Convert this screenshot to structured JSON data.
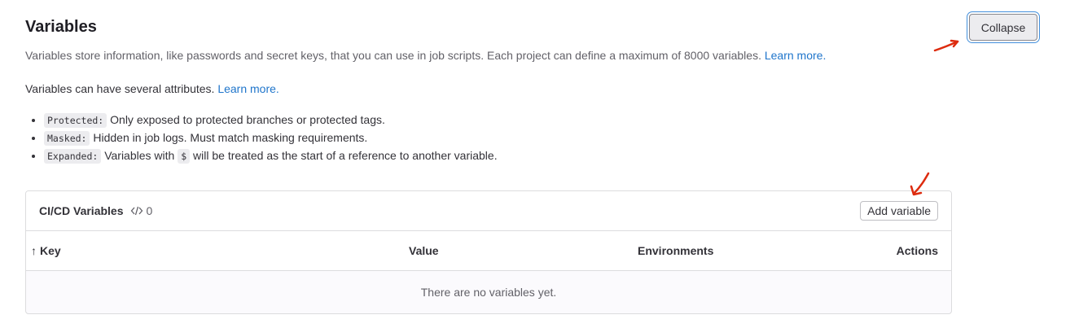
{
  "section": {
    "title": "Variables",
    "collapse_label": "Collapse",
    "description": "Variables store information, like passwords and secret keys, that you can use in job scripts. Each project can define a maximum of 8000 variables.",
    "description_link": "Learn more.",
    "attributes_intro": "Variables can have several attributes.",
    "attributes_link": "Learn more.",
    "attributes": [
      {
        "code": "Protected:",
        "text": "Only exposed to protected branches or protected tags."
      },
      {
        "code": "Masked:",
        "text": "Hidden in job logs. Must match masking requirements."
      },
      {
        "code": "Expanded:",
        "text_before": "Variables with",
        "inline_code": "$",
        "text_after": "will be treated as the start of a reference to another variable."
      }
    ]
  },
  "card": {
    "title": "CI/CD Variables",
    "count": "0",
    "count_icon": "code-icon",
    "add_label": "Add variable"
  },
  "table": {
    "sort_indicator": "↑",
    "columns": {
      "key": "Key",
      "value": "Value",
      "environments": "Environments",
      "actions": "Actions"
    },
    "empty_text": "There are no variables yet."
  },
  "colors": {
    "link": "#1f75cb",
    "annotation": "#dd2b0e",
    "focus_ring": "#428fdc"
  }
}
